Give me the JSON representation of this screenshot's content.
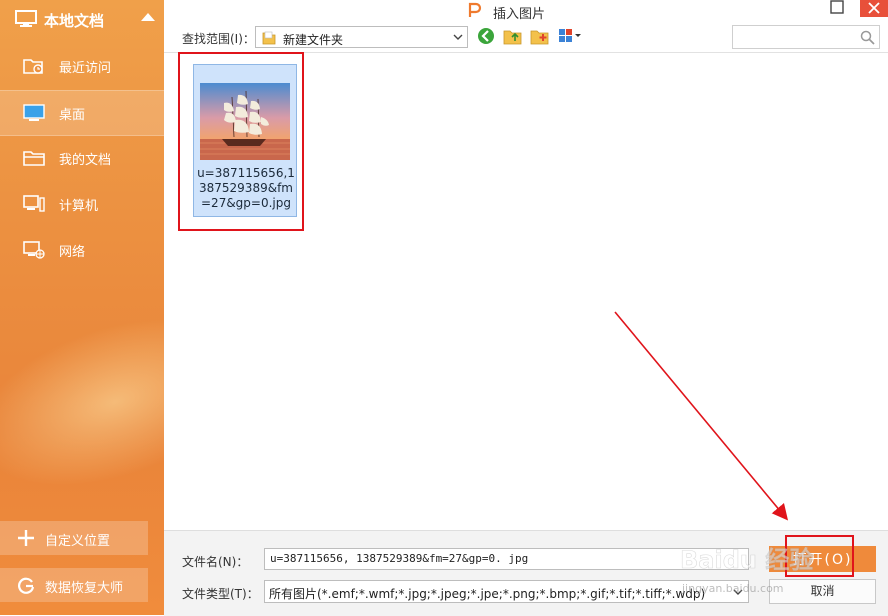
{
  "sidebar": {
    "title": "本地文档",
    "items": [
      {
        "label": "最近访问"
      },
      {
        "label": "桌面"
      },
      {
        "label": "我的文档"
      },
      {
        "label": "计算机"
      },
      {
        "label": "网络"
      }
    ],
    "custom_location": "自定义位置",
    "data_recovery": "数据恢复大师"
  },
  "window": {
    "title": "插入图片"
  },
  "toolbar": {
    "look_in_label": "查找范围(I)：",
    "look_in_value": "新建文件夹",
    "search_placeholder": ""
  },
  "files": [
    {
      "name": "u=387115656,1387529389&fm=27&gp=0.jpg",
      "selected": true
    }
  ],
  "bottom": {
    "filename_label": "文件名(N)：",
    "filename_value": "u=387115656, 1387529389&fm=27&gp=0. jpg",
    "filetype_label": "文件类型(T)：",
    "filetype_value": "所有图片(*.emf;*.wmf;*.jpg;*.jpeg;*.jpe;*.png;*.bmp;*.gif;*.tif;*.tiff;*.wdp)",
    "open_label": "打开(O)",
    "cancel_label": "取消"
  },
  "watermark": {
    "brand": "Baidu 经验",
    "url": "jingyan.baidu.com"
  },
  "colors": {
    "sidebar": "#ec9141",
    "accent": "#ef8a3b",
    "selection": "#cfe3fb",
    "annotation": "#e0141b"
  }
}
